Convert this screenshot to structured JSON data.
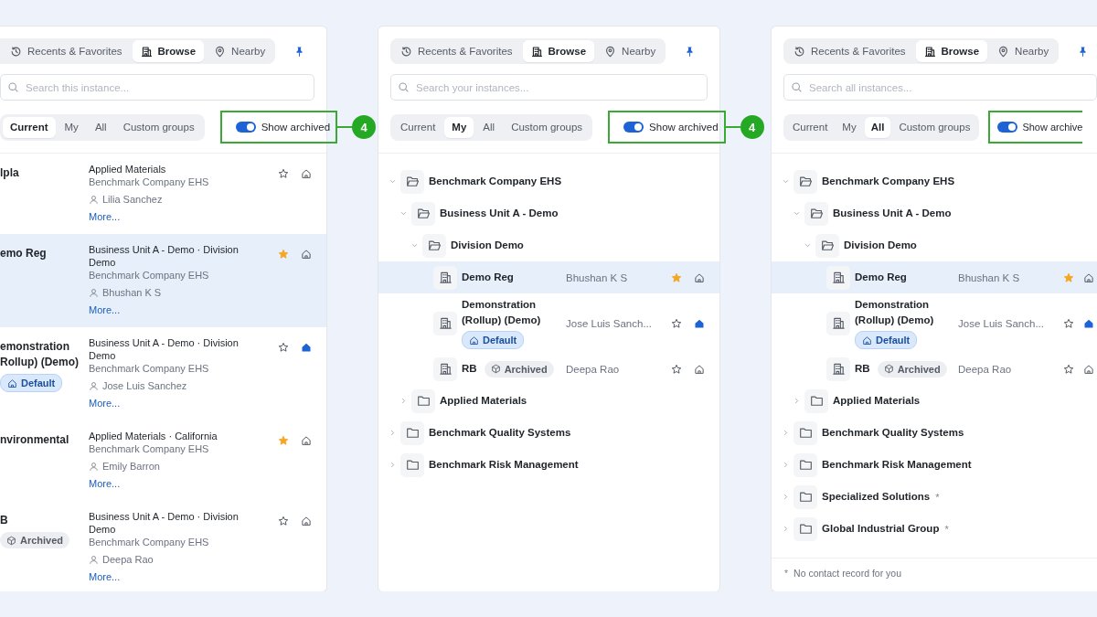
{
  "panels": [
    {
      "tabs": [
        {
          "label": "Recents & Favorites",
          "selected": false
        },
        {
          "label": "Browse",
          "selected": true
        },
        {
          "label": "Nearby",
          "selected": false
        }
      ],
      "search": {
        "placeholder": "Search this instance..."
      },
      "scopes": [
        {
          "label": "Current",
          "selected": true
        },
        {
          "label": "My",
          "selected": false
        },
        {
          "label": "All",
          "selected": false
        },
        {
          "label": "Custom groups",
          "selected": false
        }
      ],
      "show_archived": {
        "label": "Show archived",
        "on": true
      },
      "callout": "4",
      "items": [
        {
          "name": "lpla",
          "path": "Applied Materials",
          "company": "Benchmark Company EHS",
          "contact": "Lilia Sanchez",
          "more": "More...",
          "favorite": false,
          "home": false,
          "selected": false
        },
        {
          "name": "emo Reg",
          "path": "Business Unit A - Demo · Division Demo",
          "company": "Benchmark Company EHS",
          "contact": "Bhushan K S",
          "more": "More...",
          "favorite": true,
          "home": false,
          "selected": true
        },
        {
          "name": "emonstration Rollup) (Demo)",
          "badge": {
            "kind": "default",
            "label": "Default"
          },
          "path": "Business Unit A - Demo · Division Demo",
          "company": "Benchmark Company EHS",
          "contact": "Jose Luis Sanchez",
          "more": "More...",
          "favorite": false,
          "home": true,
          "selected": false
        },
        {
          "name": "nvironmental",
          "path": "Applied Materials · California",
          "company": "Benchmark Company EHS",
          "contact": "Emily Barron",
          "more": "More...",
          "favorite": true,
          "home": false,
          "selected": false
        },
        {
          "name": "B",
          "badge": {
            "kind": "archived",
            "label": "Archived"
          },
          "path": "Business Unit A - Demo · Division Demo",
          "company": "Benchmark Company EHS",
          "contact": "Deepa Rao",
          "more": "More...",
          "favorite": false,
          "home": false,
          "selected": false
        }
      ]
    },
    {
      "tabs": [
        {
          "label": "Recents & Favorites",
          "selected": false
        },
        {
          "label": "Browse",
          "selected": true
        },
        {
          "label": "Nearby",
          "selected": false
        }
      ],
      "search": {
        "placeholder": "Search your instances..."
      },
      "scopes": [
        {
          "label": "Current",
          "selected": false
        },
        {
          "label": "My",
          "selected": true
        },
        {
          "label": "All",
          "selected": false
        },
        {
          "label": "Custom groups",
          "selected": false
        }
      ],
      "show_archived": {
        "label": "Show archived",
        "on": true
      },
      "callout": "4",
      "tree": [
        {
          "kind": "folder",
          "name": "Benchmark Company EHS",
          "expanded": true,
          "selected": false,
          "children": [
            {
              "kind": "folder",
              "name": "Business Unit A - Demo",
              "expanded": true,
              "selected": false,
              "children": [
                {
                  "kind": "folder",
                  "name": "Division Demo",
                  "expanded": true,
                  "selected": false,
                  "children": [
                    {
                      "kind": "site",
                      "name": "Demo Reg",
                      "owner": "Bhushan K S",
                      "favorite": true,
                      "home": false,
                      "selected": true
                    },
                    {
                      "kind": "site",
                      "name": "Demonstration (Rollup) (Demo)",
                      "badge": {
                        "kind": "default",
                        "label": "Default"
                      },
                      "owner": "Jose Luis Sanch...",
                      "favorite": false,
                      "home": true,
                      "selected": false
                    },
                    {
                      "kind": "site",
                      "name": "RB",
                      "badge": {
                        "kind": "archived",
                        "label": "Archived"
                      },
                      "owner": "Deepa Rao",
                      "favorite": false,
                      "home": false,
                      "selected": false
                    }
                  ]
                }
              ]
            },
            {
              "kind": "folder",
              "name": "Applied Materials",
              "expanded": false,
              "selected": false
            }
          ]
        },
        {
          "kind": "folder",
          "name": "Benchmark Quality Systems",
          "expanded": false,
          "selected": false
        },
        {
          "kind": "folder",
          "name": "Benchmark Risk Management",
          "expanded": false,
          "selected": false
        }
      ]
    },
    {
      "tabs": [
        {
          "label": "Recents & Favorites",
          "selected": false
        },
        {
          "label": "Browse",
          "selected": true
        },
        {
          "label": "Nearby",
          "selected": false
        }
      ],
      "search": {
        "placeholder": "Search all instances..."
      },
      "scopes": [
        {
          "label": "Current",
          "selected": false
        },
        {
          "label": "My",
          "selected": false
        },
        {
          "label": "All",
          "selected": true
        },
        {
          "label": "Custom groups",
          "selected": false
        }
      ],
      "show_archived": {
        "label": "Show archive",
        "on": true
      },
      "tree": [
        {
          "kind": "folder",
          "name": "Benchmark Company EHS",
          "expanded": true,
          "selected": false,
          "children": [
            {
              "kind": "folder",
              "name": "Business Unit A - Demo",
              "expanded": true,
              "selected": false,
              "children": [
                {
                  "kind": "folder",
                  "name": "Division Demo",
                  "expanded": true,
                  "selected": false,
                  "children": [
                    {
                      "kind": "site",
                      "name": "Demo Reg",
                      "owner": "Bhushan K S",
                      "favorite": true,
                      "home": false,
                      "selected": true
                    },
                    {
                      "kind": "site",
                      "name": "Demonstration (Rollup) (Demo)",
                      "badge": {
                        "kind": "default",
                        "label": "Default"
                      },
                      "owner": "Jose Luis Sanch...",
                      "favorite": false,
                      "home": true,
                      "selected": false
                    },
                    {
                      "kind": "site",
                      "name": "RB",
                      "badge": {
                        "kind": "archived",
                        "label": "Archived"
                      },
                      "owner": "Deepa Rao",
                      "favorite": false,
                      "home": false,
                      "selected": false
                    }
                  ]
                }
              ]
            },
            {
              "kind": "folder",
              "name": "Applied Materials",
              "expanded": false,
              "selected": false
            }
          ]
        },
        {
          "kind": "folder",
          "name": "Benchmark Quality Systems",
          "expanded": false,
          "selected": false
        },
        {
          "kind": "folder",
          "name": "Benchmark Risk Management",
          "expanded": false,
          "selected": false
        },
        {
          "kind": "folder",
          "name": "Specialized Solutions",
          "note": "*",
          "expanded": false,
          "selected": false
        },
        {
          "kind": "folder",
          "name": "Global Industrial Group",
          "note": "*",
          "expanded": false,
          "selected": false
        }
      ],
      "footnote": {
        "mark": "*",
        "text": "No contact record for you"
      }
    }
  ]
}
